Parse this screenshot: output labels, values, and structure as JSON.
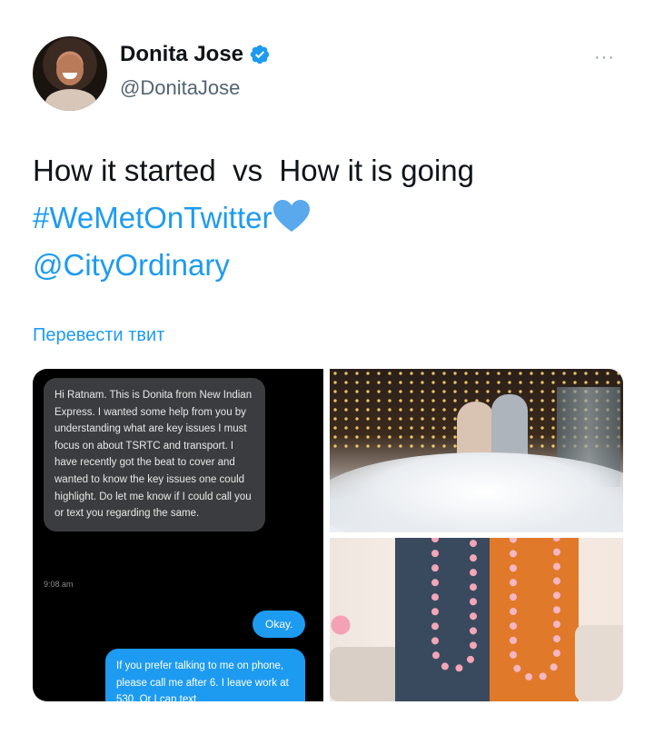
{
  "user": {
    "name": "Donita Jose",
    "handle": "@DonitaJose",
    "verified_icon": "verified-badge-icon",
    "more_label": "···"
  },
  "tweet": {
    "line1": "How it started  vs  How it is going",
    "hashtag": "#WeMetOnTwitter",
    "mention": "@CityOrdinary",
    "heart_icon": "blue-heart-icon",
    "translate_label": "Перевести твит"
  },
  "media": {
    "chat": {
      "incoming_message": "Hi Ratnam. This is Donita from New Indian Express. I wanted some help from you by understanding what are key issues I must focus on about TSRTC and transport. I have recently got the beat to cover and wanted to know the key issues one could highlight. Do let me know if I could call you or text you regarding the same.",
      "time": "9:08 am",
      "reply_ok": "Okay.",
      "reply_long": "If you prefer talking to me on phone, please call me after 6. I leave work at 530. Or I can text"
    }
  },
  "colors": {
    "accent": "#1d9bf0",
    "text": "#0f1419",
    "muted": "#536471"
  }
}
